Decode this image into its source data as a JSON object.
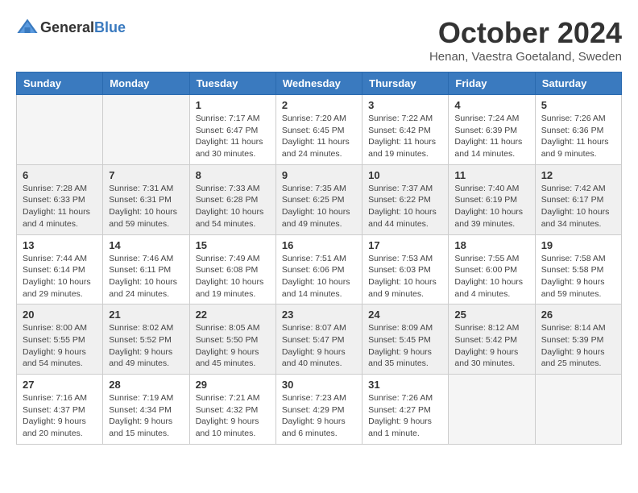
{
  "header": {
    "logo_general": "General",
    "logo_blue": "Blue",
    "month": "October 2024",
    "location": "Henan, Vaestra Goetaland, Sweden"
  },
  "weekdays": [
    "Sunday",
    "Monday",
    "Tuesday",
    "Wednesday",
    "Thursday",
    "Friday",
    "Saturday"
  ],
  "weeks": [
    [
      {
        "date": "",
        "info": ""
      },
      {
        "date": "",
        "info": ""
      },
      {
        "date": "1",
        "info": "Sunrise: 7:17 AM\nSunset: 6:47 PM\nDaylight: 11 hours and 30 minutes."
      },
      {
        "date": "2",
        "info": "Sunrise: 7:20 AM\nSunset: 6:45 PM\nDaylight: 11 hours and 24 minutes."
      },
      {
        "date": "3",
        "info": "Sunrise: 7:22 AM\nSunset: 6:42 PM\nDaylight: 11 hours and 19 minutes."
      },
      {
        "date": "4",
        "info": "Sunrise: 7:24 AM\nSunset: 6:39 PM\nDaylight: 11 hours and 14 minutes."
      },
      {
        "date": "5",
        "info": "Sunrise: 7:26 AM\nSunset: 6:36 PM\nDaylight: 11 hours and 9 minutes."
      }
    ],
    [
      {
        "date": "6",
        "info": "Sunrise: 7:28 AM\nSunset: 6:33 PM\nDaylight: 11 hours and 4 minutes."
      },
      {
        "date": "7",
        "info": "Sunrise: 7:31 AM\nSunset: 6:31 PM\nDaylight: 10 hours and 59 minutes."
      },
      {
        "date": "8",
        "info": "Sunrise: 7:33 AM\nSunset: 6:28 PM\nDaylight: 10 hours and 54 minutes."
      },
      {
        "date": "9",
        "info": "Sunrise: 7:35 AM\nSunset: 6:25 PM\nDaylight: 10 hours and 49 minutes."
      },
      {
        "date": "10",
        "info": "Sunrise: 7:37 AM\nSunset: 6:22 PM\nDaylight: 10 hours and 44 minutes."
      },
      {
        "date": "11",
        "info": "Sunrise: 7:40 AM\nSunset: 6:19 PM\nDaylight: 10 hours and 39 minutes."
      },
      {
        "date": "12",
        "info": "Sunrise: 7:42 AM\nSunset: 6:17 PM\nDaylight: 10 hours and 34 minutes."
      }
    ],
    [
      {
        "date": "13",
        "info": "Sunrise: 7:44 AM\nSunset: 6:14 PM\nDaylight: 10 hours and 29 minutes."
      },
      {
        "date": "14",
        "info": "Sunrise: 7:46 AM\nSunset: 6:11 PM\nDaylight: 10 hours and 24 minutes."
      },
      {
        "date": "15",
        "info": "Sunrise: 7:49 AM\nSunset: 6:08 PM\nDaylight: 10 hours and 19 minutes."
      },
      {
        "date": "16",
        "info": "Sunrise: 7:51 AM\nSunset: 6:06 PM\nDaylight: 10 hours and 14 minutes."
      },
      {
        "date": "17",
        "info": "Sunrise: 7:53 AM\nSunset: 6:03 PM\nDaylight: 10 hours and 9 minutes."
      },
      {
        "date": "18",
        "info": "Sunrise: 7:55 AM\nSunset: 6:00 PM\nDaylight: 10 hours and 4 minutes."
      },
      {
        "date": "19",
        "info": "Sunrise: 7:58 AM\nSunset: 5:58 PM\nDaylight: 9 hours and 59 minutes."
      }
    ],
    [
      {
        "date": "20",
        "info": "Sunrise: 8:00 AM\nSunset: 5:55 PM\nDaylight: 9 hours and 54 minutes."
      },
      {
        "date": "21",
        "info": "Sunrise: 8:02 AM\nSunset: 5:52 PM\nDaylight: 9 hours and 49 minutes."
      },
      {
        "date": "22",
        "info": "Sunrise: 8:05 AM\nSunset: 5:50 PM\nDaylight: 9 hours and 45 minutes."
      },
      {
        "date": "23",
        "info": "Sunrise: 8:07 AM\nSunset: 5:47 PM\nDaylight: 9 hours and 40 minutes."
      },
      {
        "date": "24",
        "info": "Sunrise: 8:09 AM\nSunset: 5:45 PM\nDaylight: 9 hours and 35 minutes."
      },
      {
        "date": "25",
        "info": "Sunrise: 8:12 AM\nSunset: 5:42 PM\nDaylight: 9 hours and 30 minutes."
      },
      {
        "date": "26",
        "info": "Sunrise: 8:14 AM\nSunset: 5:39 PM\nDaylight: 9 hours and 25 minutes."
      }
    ],
    [
      {
        "date": "27",
        "info": "Sunrise: 7:16 AM\nSunset: 4:37 PM\nDaylight: 9 hours and 20 minutes."
      },
      {
        "date": "28",
        "info": "Sunrise: 7:19 AM\nSunset: 4:34 PM\nDaylight: 9 hours and 15 minutes."
      },
      {
        "date": "29",
        "info": "Sunrise: 7:21 AM\nSunset: 4:32 PM\nDaylight: 9 hours and 10 minutes."
      },
      {
        "date": "30",
        "info": "Sunrise: 7:23 AM\nSunset: 4:29 PM\nDaylight: 9 hours and 6 minutes."
      },
      {
        "date": "31",
        "info": "Sunrise: 7:26 AM\nSunset: 4:27 PM\nDaylight: 9 hours and 1 minute."
      },
      {
        "date": "",
        "info": ""
      },
      {
        "date": "",
        "info": ""
      }
    ]
  ]
}
